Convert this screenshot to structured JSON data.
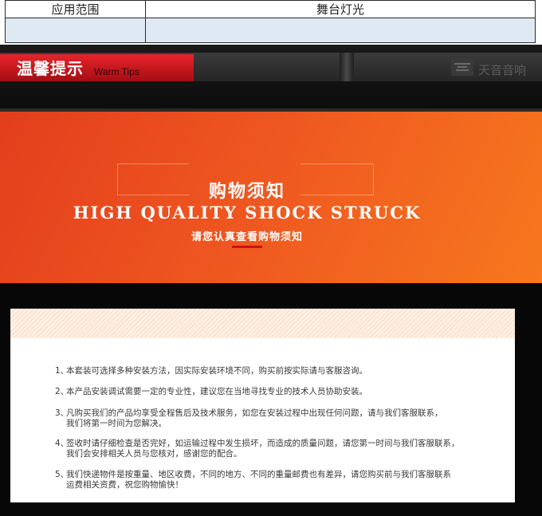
{
  "spec_table": {
    "row1": {
      "label": "应用范围",
      "value": "舞台灯光"
    },
    "row2": {
      "label": "",
      "value": ""
    }
  },
  "tips_bar": {
    "title": "温馨提示",
    "subtitle": "Warm Tips",
    "brand_name": "天音音响"
  },
  "banner": {
    "title": "购物须知",
    "english_title": "HIGH QUALITY SHOCK STRUCK",
    "subtitle": "请您认真查看购物须知"
  },
  "notice": {
    "items": [
      {
        "num": "1、",
        "text": "本套装可选择多种安装方法，因实际安装环境不同，购买前按实际请与客服咨询。"
      },
      {
        "num": "2、",
        "text": "本产品安装调试需要一定的专业性，建议您在当地寻找专业的技术人员协助安装。"
      },
      {
        "num": "3、",
        "text": "凡购买我们的产品均享受全程售后及技术服务，如您在安装过程中出现任何问题，请与我们客服联系，",
        "text2": "我们将第一时间为您解决。"
      },
      {
        "num": "4、",
        "text": "签收时请仔细检查是否完好，如运输过程中发生损坏，而造成的质量问题，请您第一时间与我们客服联系，",
        "text2": "我们会安排相关人员与您核对，感谢您的配合。"
      },
      {
        "num": "5、",
        "text": "我们快递物件是按重量、地区收费，不同的地方、不同的重量邮费也有差异，请您购买前与我们客服联系",
        "text2": "运费相关资费，祝您购物愉快！"
      }
    ]
  },
  "colors": {
    "tips_red": "#d81c22",
    "banner_orange": "#ee5620",
    "table_row_fill": "#dfe9f4"
  }
}
